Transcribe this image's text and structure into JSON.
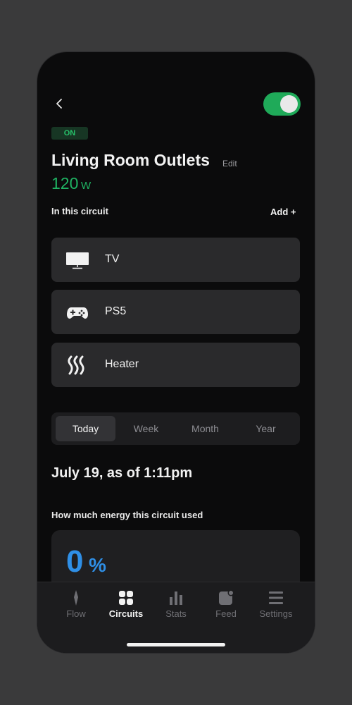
{
  "header": {
    "back_icon": "chevron-left-icon",
    "toggle_on": true
  },
  "circuit": {
    "status_badge": "ON",
    "name": "Living Room Outlets",
    "edit_label": "Edit",
    "power_value": "120",
    "power_unit": "W"
  },
  "devices_section": {
    "label": "In this circuit",
    "add_label": "Add +",
    "items": [
      {
        "label": "TV",
        "icon": "tv-icon"
      },
      {
        "label": "PS5",
        "icon": "gamepad-icon"
      },
      {
        "label": "Heater",
        "icon": "heater-icon"
      }
    ]
  },
  "range_tabs": {
    "options": [
      "Today",
      "Week",
      "Month",
      "Year"
    ],
    "selected": "Today"
  },
  "date_heading": "July 19, as of 1:11pm",
  "usage": {
    "label": "How much energy this circuit used",
    "percent_value": "0",
    "percent_sign": "%"
  },
  "tabbar": {
    "items": [
      {
        "label": "Flow",
        "icon": "flow-icon"
      },
      {
        "label": "Circuits",
        "icon": "circuits-icon"
      },
      {
        "label": "Stats",
        "icon": "stats-icon"
      },
      {
        "label": "Feed",
        "icon": "feed-icon"
      },
      {
        "label": "Settings",
        "icon": "settings-icon"
      }
    ],
    "active": "Circuits"
  },
  "colors": {
    "accent_green": "#1fb463",
    "accent_blue": "#2f8fe6",
    "background": "#0b0b0c",
    "card": "#2a2a2c"
  }
}
